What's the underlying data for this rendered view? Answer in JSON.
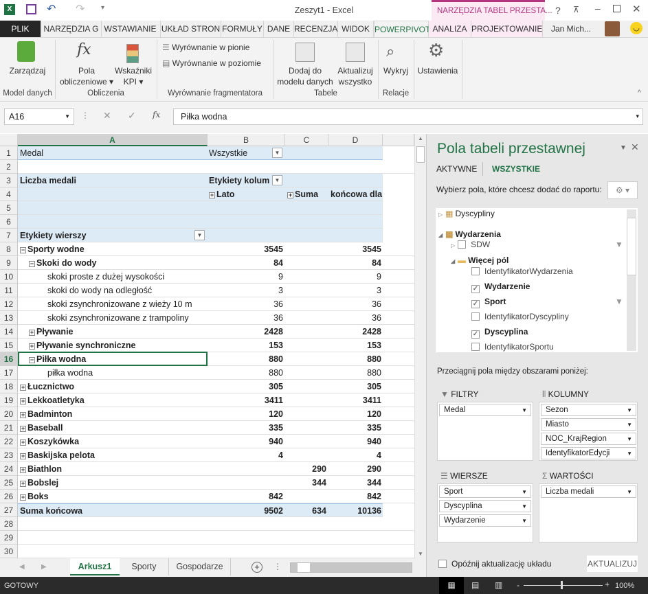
{
  "window": {
    "title": "Zeszyt1 - Excel",
    "context_tab_group": "NARZĘDZIA TABEL PRZESTA...",
    "user": "Jan Mich...",
    "help": "?"
  },
  "tabs": [
    {
      "label": "PLIK"
    },
    {
      "label": "NARZĘDZIA G"
    },
    {
      "label": "WSTAWIANIE"
    },
    {
      "label": "UKŁAD STRON"
    },
    {
      "label": "FORMUŁY"
    },
    {
      "label": "DANE"
    },
    {
      "label": "RECENZJA"
    },
    {
      "label": "WIDOK"
    },
    {
      "label": "POWERPIVOT",
      "active": true
    },
    {
      "label": "ANALIZA"
    },
    {
      "label": "PROJEKTOWANIE"
    }
  ],
  "ribbon": {
    "manage": "Zarządzaj",
    "calc_fields_1": "Pola",
    "calc_fields_2": "obliczeniowe ▾",
    "kpi_1": "Wskaźniki",
    "kpi_2": "KPI ▾",
    "align_vertical": "Wyrównanie w pionie",
    "align_horizontal": "Wyrównanie w poziomie",
    "add_model_1": "Dodaj do",
    "add_model_2": "modelu danych",
    "refresh_1": "Aktualizuj",
    "refresh_2": "wszystko",
    "detect": "Wykryj",
    "settings": "Ustawienia",
    "groups": {
      "model": "Model danych",
      "calc": "Obliczenia",
      "slicer": "Wyrównanie fragmentatora",
      "tables": "Tabele",
      "relations": "Relacje"
    }
  },
  "formula_bar": {
    "name_box": "A16",
    "formula": "Piłka wodna"
  },
  "columns": [
    "A",
    "B",
    "C",
    "D"
  ],
  "rows": [
    {
      "n": 1,
      "a": "Medal",
      "b": "Wszystkie",
      "blue": true,
      "bdd": true
    },
    {
      "n": 2
    },
    {
      "n": 3,
      "a": "Liczba medali",
      "b": "Etykiety kolum",
      "blue": true,
      "ab": true,
      "bb": true,
      "bdd": true
    },
    {
      "n": 4,
      "b": "Lato",
      "c": "Suma",
      "d": "końcowa dla",
      "blue": true,
      "bb": true,
      "bexp": "+",
      "cexp": "+"
    },
    {
      "n": 5,
      "blue": true
    },
    {
      "n": 6,
      "blue": true
    },
    {
      "n": 7,
      "a": "Etykiety wierszy",
      "blue": true,
      "ab": true,
      "afilter": true
    },
    {
      "n": 8,
      "a": "Sporty wodne",
      "b": "3545",
      "d": "3545",
      "lvl": 0,
      "exp": "−",
      "bold": true
    },
    {
      "n": 9,
      "a": "Skoki do wody",
      "b": "84",
      "d": "84",
      "lvl": 1,
      "exp": "−",
      "bold": true
    },
    {
      "n": 10,
      "a": "skoki proste z dużej wysokości",
      "b": "9",
      "d": "9",
      "lvl": 2
    },
    {
      "n": 11,
      "a": "skoki do wody na odległość",
      "b": "3",
      "d": "3",
      "lvl": 2
    },
    {
      "n": 12,
      "a": "skoki zsynchronizowane z wieży 10 m",
      "b": "36",
      "d": "36",
      "lvl": 2
    },
    {
      "n": 13,
      "a": "skoki zsynchronizowane z trampoliny",
      "b": "36",
      "d": "36",
      "lvl": 2
    },
    {
      "n": 14,
      "a": "Pływanie",
      "b": "2428",
      "d": "2428",
      "lvl": 1,
      "exp": "+",
      "bold": true
    },
    {
      "n": 15,
      "a": "Pływanie synchroniczne",
      "b": "153",
      "d": "153",
      "lvl": 1,
      "exp": "+",
      "bold": true
    },
    {
      "n": 16,
      "a": "Piłka wodna",
      "b": "880",
      "d": "880",
      "lvl": 1,
      "exp": "−",
      "bold": true,
      "selected": true
    },
    {
      "n": 17,
      "a": "piłka wodna",
      "b": "880",
      "d": "880",
      "lvl": 2
    },
    {
      "n": 18,
      "a": "Łucznictwo",
      "b": "305",
      "d": "305",
      "lvl": 0,
      "exp": "+",
      "bold": true
    },
    {
      "n": 19,
      "a": "Lekkoatletyka",
      "b": "3411",
      "d": "3411",
      "lvl": 0,
      "exp": "+",
      "bold": true
    },
    {
      "n": 20,
      "a": "Badminton",
      "b": "120",
      "d": "120",
      "lvl": 0,
      "exp": "+",
      "bold": true
    },
    {
      "n": 21,
      "a": "Baseball",
      "b": "335",
      "d": "335",
      "lvl": 0,
      "exp": "+",
      "bold": true
    },
    {
      "n": 22,
      "a": "Koszykówka",
      "b": "940",
      "d": "940",
      "lvl": 0,
      "exp": "+",
      "bold": true
    },
    {
      "n": 23,
      "a": "Baskijska pelota",
      "b": "4",
      "d": "4",
      "lvl": 0,
      "exp": "+",
      "bold": true
    },
    {
      "n": 24,
      "a": "Biathlon",
      "c": "290",
      "d": "290",
      "lvl": 0,
      "exp": "+",
      "bold": true
    },
    {
      "n": 25,
      "a": "Bobslej",
      "c": "344",
      "d": "344",
      "lvl": 0,
      "exp": "+",
      "bold": true
    },
    {
      "n": 26,
      "a": "Boks",
      "b": "842",
      "d": "842",
      "lvl": 0,
      "exp": "+",
      "bold": true
    },
    {
      "n": 27,
      "a": "Suma końcowa",
      "b": "9502",
      "c": "634",
      "d": "10136",
      "bold": true,
      "total": true
    },
    {
      "n": 28
    },
    {
      "n": 29
    },
    {
      "n": 30
    }
  ],
  "sheets": [
    {
      "label": "Arkusz1",
      "active": true
    },
    {
      "label": "Sporty"
    },
    {
      "label": "Gospodarze"
    }
  ],
  "status": {
    "text": "GOTOWY",
    "zoom": "100%"
  },
  "pane": {
    "title": "Pola tabeli przestawnej",
    "tab_active": "AKTYWNE",
    "tab_all": "WSZYSTKIE",
    "choose": "Wybierz pola, które chcesz dodać do raportu:",
    "fields": [
      {
        "label": "Dyscypliny",
        "type": "table",
        "level": 0,
        "expander": "▷"
      },
      {
        "label": "Wydarzenia",
        "type": "table",
        "level": 0,
        "expander": "◢",
        "bold": true
      },
      {
        "label": "SDW",
        "type": "field",
        "level": 1,
        "expander": "▷",
        "checked": false,
        "filter": true
      },
      {
        "label": "Więcej pól",
        "type": "folder",
        "level": 1,
        "expander": "◢",
        "bold": true
      },
      {
        "label": "IdentyfikatorWydarzenia",
        "type": "field",
        "level": 2,
        "checked": false
      },
      {
        "label": "Wydarzenie",
        "type": "field",
        "level": 2,
        "checked": true,
        "bold": true
      },
      {
        "label": "Sport",
        "type": "field",
        "level": 2,
        "checked": true,
        "bold": true,
        "filter": true
      },
      {
        "label": "IdentyfikatorDyscypliny",
        "type": "field",
        "level": 2,
        "checked": false
      },
      {
        "label": "Dyscyplina",
        "type": "field",
        "level": 2,
        "checked": true,
        "bold": true
      },
      {
        "label": "IdentyfikatorSportu",
        "type": "field",
        "level": 2,
        "checked": false
      }
    ],
    "drag_hint": "Przeciągnij pola między obszarami poniżej:",
    "filters_label": "FILTRY",
    "columns_label": "KOLUMNY",
    "rows_label": "WIERSZE",
    "values_label": "WARTOŚCI",
    "filters": [
      "Medal"
    ],
    "columns": [
      "Sezon",
      "Miasto",
      "NOC_KrajRegion",
      "IdentyfikatorEdycji"
    ],
    "rows": [
      "Sport",
      "Dyscyplina",
      "Wydarzenie"
    ],
    "values": [
      "Liczba medali"
    ],
    "defer": "Opóźnij aktualizację układu",
    "update": "AKTUALIZUJ"
  },
  "colors": {
    "accent": "#217346",
    "context": "#b1367e",
    "pivot_header": "#ddebf7"
  }
}
